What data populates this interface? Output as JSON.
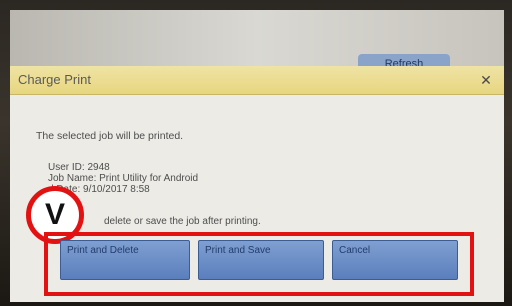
{
  "header": {
    "refresh_label": "Refresh"
  },
  "dialog": {
    "title": "Charge Print",
    "close_icon": "close-icon",
    "message": "The selected job will be printed.",
    "user_id": "User ID: 2948",
    "job_name": "Job Name: Print Utility for Android",
    "date": "d Date: 9/10/2017 8:58",
    "instruction": "delete or save the job after printing."
  },
  "annotation": {
    "badge_label": "V",
    "highlight_color": "#e31212"
  },
  "actions": {
    "print_and_delete": "Print and Delete",
    "print_and_save": "Print and Save",
    "cancel": "Cancel"
  }
}
